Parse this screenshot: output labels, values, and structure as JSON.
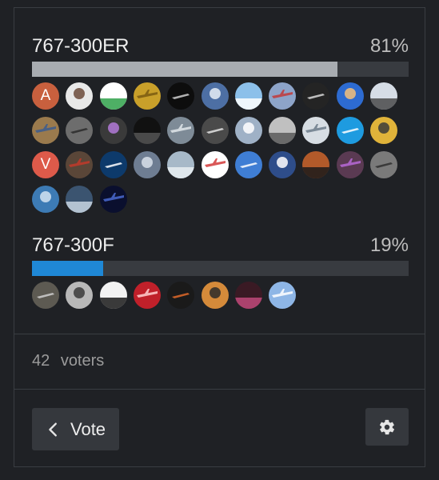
{
  "options": [
    {
      "name": "767-300ER",
      "percent_label": "81%",
      "percent": 81,
      "fill_color": "#a8acb1",
      "voters": [
        {
          "letter": "A",
          "color": "#c8603e",
          "bg": "#c8603e"
        },
        {
          "letter": "",
          "bg": "#e8e8e8",
          "accent": "#6b4a3a"
        },
        {
          "letter": "",
          "bg": "#ffffff",
          "accent": "#2fa14a"
        },
        {
          "letter": "",
          "bg": "#c9a02a",
          "accent": "#7a5a10"
        },
        {
          "letter": "",
          "bg": "#0d0d0d",
          "accent": "#cfcfcf"
        },
        {
          "letter": "",
          "bg": "#4d6fa4",
          "accent": "#e8eef7"
        },
        {
          "letter": "",
          "bg": "#8cc0ea",
          "accent": "#ffffff"
        },
        {
          "letter": "",
          "bg": "#8da4c9",
          "accent": "#c23a3a"
        },
        {
          "letter": "",
          "bg": "#242424",
          "accent": "#d8d8d8"
        },
        {
          "letter": "",
          "bg": "#2d6bd1",
          "accent": "#f4c07a"
        },
        {
          "letter": "",
          "bg": "#d6dde6",
          "accent": "#4a4a4a"
        },
        {
          "letter": "",
          "bg": "#9a7a4d",
          "accent": "#3b5c8f"
        },
        {
          "letter": "",
          "bg": "#6d6d6d",
          "accent": "#2a2a2a"
        },
        {
          "letter": "",
          "bg": "#3a3a3a",
          "accent": "#b37ad8"
        },
        {
          "letter": "",
          "bg": "#111111",
          "accent": "#555555"
        },
        {
          "letter": "",
          "bg": "#7e8b97",
          "accent": "#e1e6ea"
        },
        {
          "letter": "",
          "bg": "#4a4a4a",
          "accent": "#e4e4e4"
        },
        {
          "letter": "",
          "bg": "#9fb1c6",
          "accent": "#ffffff"
        },
        {
          "letter": "",
          "bg": "#c0c0c0",
          "accent": "#5a5a5a"
        },
        {
          "letter": "",
          "bg": "#d7dde3",
          "accent": "#6c7b8a"
        },
        {
          "letter": "",
          "bg": "#1e9be0",
          "accent": "#ffffff"
        },
        {
          "letter": "",
          "bg": "#e0b33a",
          "accent": "#3a3a3a"
        },
        {
          "letter": "V",
          "bg": "#dd5a4a"
        },
        {
          "letter": "",
          "bg": "#5a4638",
          "accent": "#c23a2a"
        },
        {
          "letter": "",
          "bg": "#0d3a6b",
          "accent": "#ffffff"
        },
        {
          "letter": "",
          "bg": "#6e7d92",
          "accent": "#d9e1ea"
        },
        {
          "letter": "",
          "bg": "#a7b9c8",
          "accent": "#e9eef2"
        },
        {
          "letter": "",
          "bg": "#ffffff",
          "accent": "#d23a3a"
        },
        {
          "letter": "",
          "bg": "#3f7ed4",
          "accent": "#ffffff"
        },
        {
          "letter": "",
          "bg": "#2e4d8a",
          "accent": "#ffffff"
        },
        {
          "letter": "",
          "bg": "#b25a2a",
          "accent": "#1a1a1a"
        },
        {
          "letter": "",
          "bg": "#5a3a52",
          "accent": "#b96ad8"
        },
        {
          "letter": "",
          "bg": "#7a7a7a",
          "accent": "#2f2f2f"
        },
        {
          "letter": "",
          "bg": "#3d7bb5",
          "accent": "#d3e4f2"
        },
        {
          "letter": "",
          "bg": "#3b5470",
          "accent": "#c9d6e2"
        },
        {
          "letter": "",
          "bg": "#0a0f2e",
          "accent": "#4a6ad0"
        }
      ]
    },
    {
      "name": "767-300F",
      "percent_label": "19%",
      "percent": 19,
      "fill_color": "#1f88d6",
      "voters": [
        {
          "letter": "",
          "bg": "#5d5a52",
          "accent": "#cfcfcf"
        },
        {
          "letter": "",
          "bg": "#b8b8b8",
          "accent": "#3a3a3a"
        },
        {
          "letter": "",
          "bg": "#f2f2f2",
          "accent": "#1a1a1a"
        },
        {
          "letter": "",
          "bg": "#c0202a",
          "accent": "#ffd0d0"
        },
        {
          "letter": "",
          "bg": "#1a1a1a",
          "accent": "#e06a2a"
        },
        {
          "letter": "",
          "bg": "#d48a3a",
          "accent": "#2a2a2a"
        },
        {
          "letter": "",
          "bg": "#3a1a24",
          "accent": "#c04a7a"
        },
        {
          "letter": "",
          "bg": "#8eb6e6",
          "accent": "#ffffff"
        }
      ]
    }
  ],
  "footer": {
    "voters_count": "42",
    "voters_label": "voters",
    "vote_button_label": "Vote",
    "vote_icon": "chevron-left-icon",
    "settings_icon": "gear-icon"
  },
  "colors": {
    "background": "#1f2125",
    "border": "#3a3d42",
    "button_bg": "#35383d",
    "bar_track": "#383b40"
  }
}
